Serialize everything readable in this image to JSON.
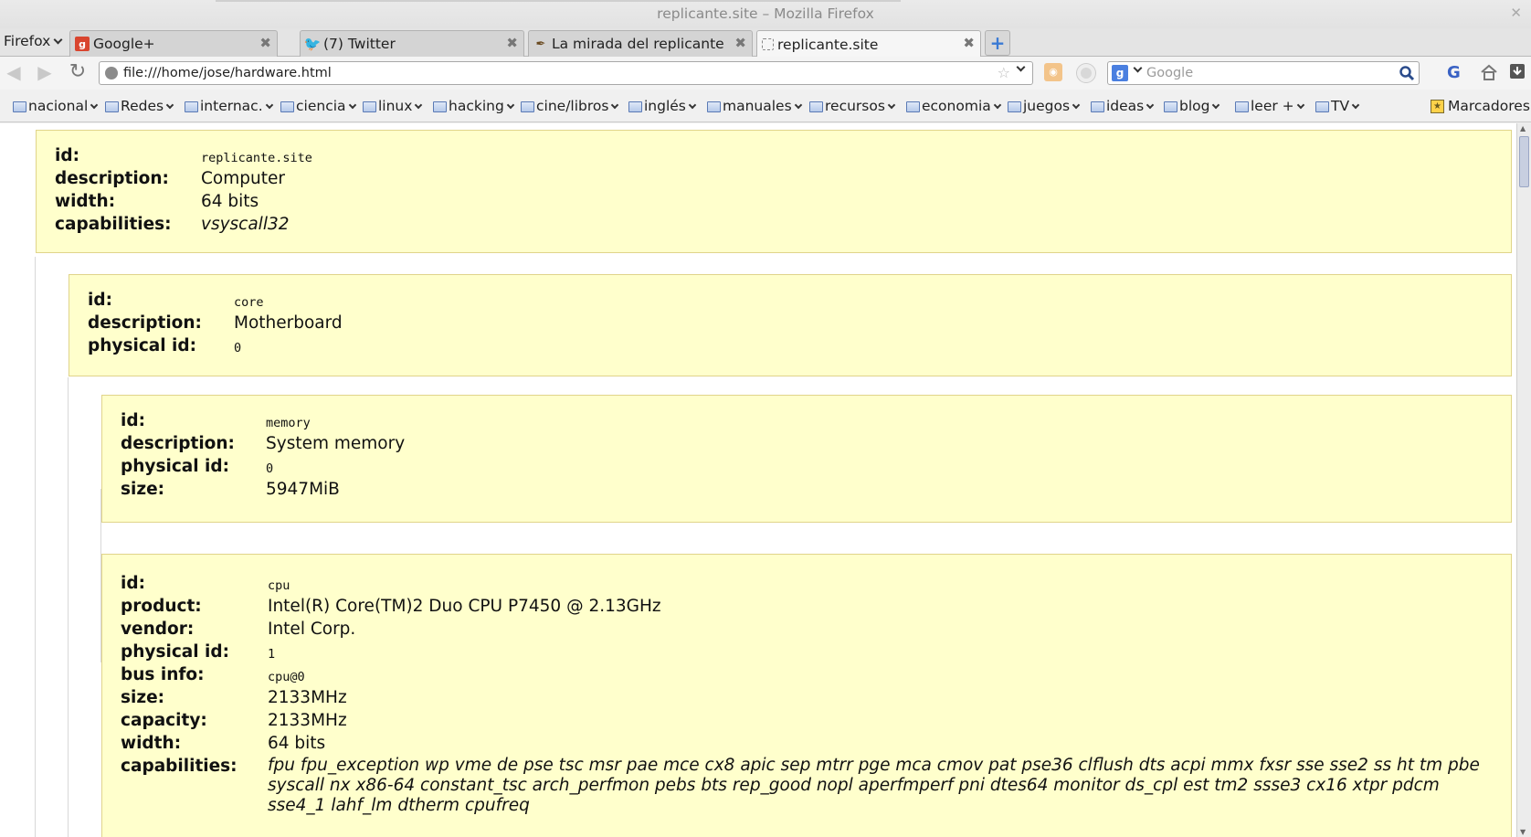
{
  "window": {
    "title": "replicante.site – Mozilla Firefox"
  },
  "app_menu": {
    "label": "Firefox"
  },
  "tabs": [
    {
      "label": "Google+"
    },
    {
      "label": "(7) Twitter"
    },
    {
      "label": "La mirada del replicante"
    },
    {
      "label": "replicante.site"
    }
  ],
  "navbar": {
    "url": "file:///home/jose/hardware.html",
    "search_placeholder": "Google",
    "ext_label": "G"
  },
  "bookmarks": {
    "folders": [
      "nacional",
      "Redes",
      "internac.",
      "ciencia",
      "linux",
      "hacking",
      "cine/libros",
      "inglés",
      "manuales",
      "recursos",
      "economia",
      "juegos",
      "ideas",
      "blog",
      "leer +",
      "TV"
    ],
    "menu_label": "Marcadores"
  },
  "nodes": {
    "computer": {
      "id_label": "id:",
      "id": "replicante.site",
      "description_label": "description:",
      "description": "Computer",
      "width_label": "width:",
      "width": "64 bits",
      "capabilities_label": "capabilities:",
      "capabilities": "vsyscall32"
    },
    "core": {
      "id_label": "id:",
      "id": "core",
      "description_label": "description:",
      "description": "Motherboard",
      "physical_id_label": "physical id:",
      "physical_id": "0"
    },
    "memory": {
      "id_label": "id:",
      "id": "memory",
      "description_label": "description:",
      "description": "System memory",
      "physical_id_label": "physical id:",
      "physical_id": "0",
      "size_label": "size:",
      "size": "5947MiB"
    },
    "cpu": {
      "id_label": "id:",
      "id": "cpu",
      "product_label": "product:",
      "product": "Intel(R) Core(TM)2 Duo CPU P7450 @ 2.13GHz",
      "vendor_label": "vendor:",
      "vendor": "Intel Corp.",
      "physical_id_label": "physical id:",
      "physical_id": "1",
      "bus_info_label": "bus info:",
      "bus_info": "cpu@0",
      "size_label": "size:",
      "size": "2133MHz",
      "capacity_label": "capacity:",
      "capacity": "2133MHz",
      "width_label": "width:",
      "width": "64 bits",
      "capabilities_label": "capabilities:",
      "capabilities": "fpu fpu_exception wp vme de pse tsc msr pae mce cx8 apic sep mtrr pge mca cmov pat pse36 clflush dts acpi mmx fxsr sse sse2 ss ht tm pbe syscall nx x86-64 constant_tsc arch_perfmon pebs bts rep_good nopl aperfmperf pni dtes64 monitor ds_cpl est tm2 ssse3 cx16 xtpr pdcm sse4_1 lahf_lm dtherm cpufreq"
    }
  }
}
